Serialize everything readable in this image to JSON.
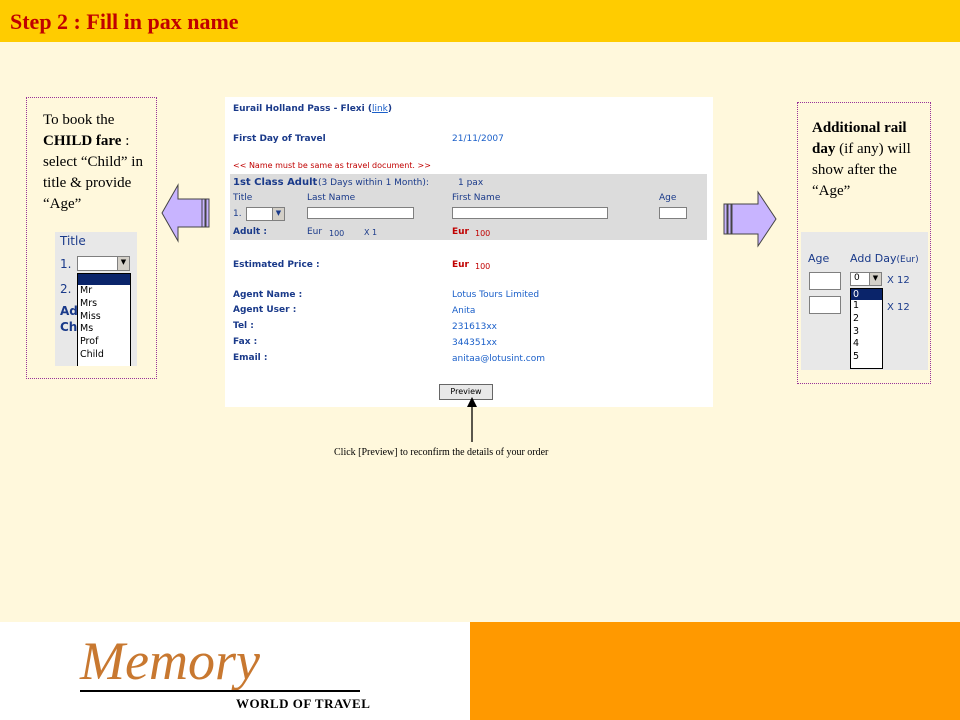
{
  "slide": {
    "title": "Step 2 : Fill in pax name"
  },
  "left_callout": {
    "line1": "To book the",
    "child_fare": "CHILD fare",
    "colon": " :",
    "rest": "select “Child” in title & provide “Age”"
  },
  "right_callout": {
    "bold": "Additional rail day",
    "rest": " (if any) will show after the “Age”"
  },
  "title_dropdown": {
    "header": "Title",
    "row_num": "1.",
    "row2": "2.",
    "partial1": "Ad",
    "partial2": "Ch",
    "options": [
      "",
      "Mr",
      "Mrs",
      "Miss",
      "Ms",
      "Prof",
      "Child"
    ]
  },
  "day_dropdown": {
    "age_header": "Age",
    "add_day_header": "Add Day",
    "eur": "(Eur)",
    "selected": "0",
    "times": "X 12",
    "options": [
      "0",
      "1",
      "2",
      "3",
      "4",
      "5"
    ]
  },
  "booking_form": {
    "pass_title": "Eurail Holland Pass - Flexi (",
    "link": "link",
    "link_close": ")",
    "first_day_label": "First Day of Travel",
    "first_day_value": "21/11/2007",
    "name_note": "<< Name must be same as travel document. >>",
    "class_label": "1st Class Adult",
    "class_detail": "(3 Days within 1 Month):",
    "pax": "1 pax",
    "columns": {
      "title": "Title",
      "last_name": "Last Name",
      "first_name": "First Name",
      "age": "Age"
    },
    "row_num": "1.",
    "adult_label": "Adult :",
    "adult_currency": "Eur",
    "adult_price": "100",
    "adult_qty": "X 1",
    "adult_total_currency": "Eur",
    "adult_total": "100",
    "estimated_label": "Estimated Price :",
    "estimated_currency": "Eur",
    "estimated_value": "100",
    "agent_name_label": "Agent Name :",
    "agent_name": "Lotus Tours Limited",
    "agent_user_label": "Agent User :",
    "agent_user": "Anita",
    "tel_label": "Tel :",
    "tel": "231613xx",
    "fax_label": "Fax :",
    "fax": "344351xx",
    "email_label": "Email :",
    "email": "anitaa@lotusint.com",
    "preview_button": "Preview"
  },
  "caption": "Click [Preview] to reconfirm the details of your order",
  "logo": {
    "brand": "Memory",
    "tagline": "WORLD OF TRAVEL"
  },
  "colors": {
    "title_bar": "#ffcc00",
    "title_text": "#c00000",
    "background": "#fff8dc",
    "footer_orange": "#ff9900",
    "arrow_fill": "#c8b4ff"
  }
}
